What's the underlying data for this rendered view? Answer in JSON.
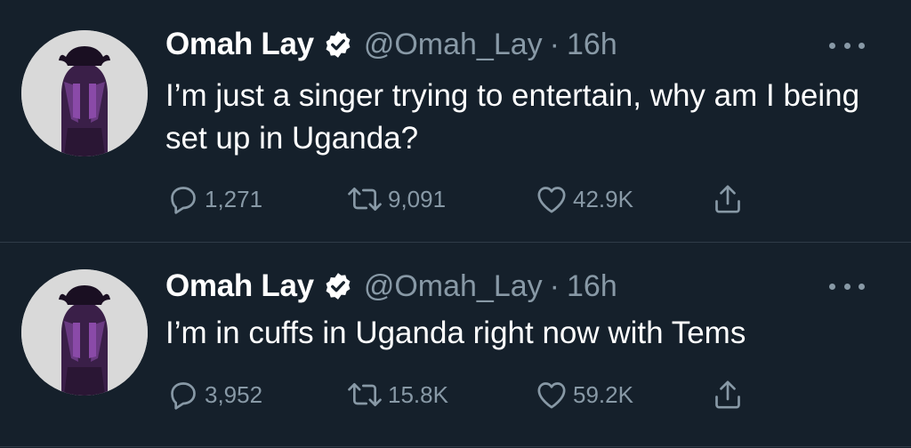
{
  "tweets": [
    {
      "author": {
        "display_name": "Omah Lay",
        "handle": "@Omah_Lay",
        "verified": true
      },
      "separator": "·",
      "time": "16h",
      "text": "I’m just a singer trying to entertain, why am I being set up in Uganda?",
      "stats": {
        "replies": "1,271",
        "retweets": "9,091",
        "likes": "42.9K"
      }
    },
    {
      "author": {
        "display_name": "Omah Lay",
        "handle": "@Omah_Lay",
        "verified": true
      },
      "separator": "·",
      "time": "16h",
      "text": "I’m in cuffs in Uganda right now with Tems",
      "stats": {
        "replies": "3,952",
        "retweets": "15.8K",
        "likes": "59.2K"
      }
    }
  ],
  "icons": {
    "reply": "reply-icon",
    "retweet": "retweet-icon",
    "like": "heart-icon",
    "share": "share-icon",
    "more": "more-icon",
    "verified": "verified-badge-icon"
  },
  "colors": {
    "background": "#15202b",
    "primary_text": "#ffffff",
    "secondary_text": "#8899a6",
    "divider": "#2f3b47",
    "avatar_bg": "#d9d9d9",
    "avatar_figure": "#4a2a5a"
  }
}
